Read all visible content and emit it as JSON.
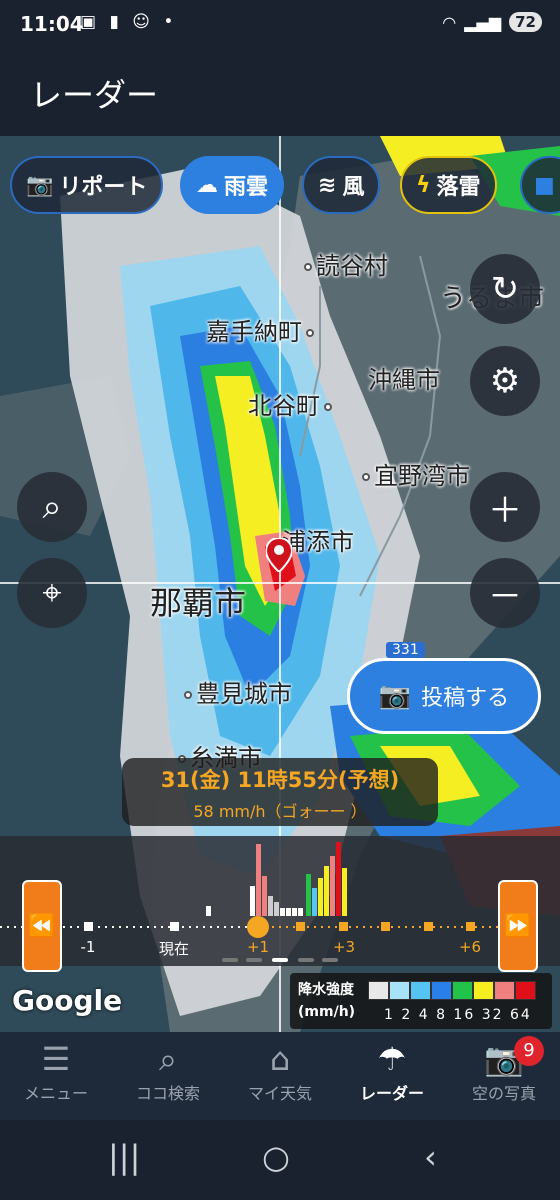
{
  "status": {
    "time": "11:04",
    "battery": "72"
  },
  "header": {
    "title": "レーダー"
  },
  "layers": [
    {
      "label": "リポート",
      "icon": "camera-icon"
    },
    {
      "label": "雨雲",
      "icon": "rain-cloud-icon"
    },
    {
      "label": "風",
      "icon": "wind-icon"
    },
    {
      "label": "落雷",
      "icon": "lightning-icon"
    }
  ],
  "places": {
    "yomitan": "読谷村",
    "uruma": "うるま市",
    "kadena": "嘉手納町",
    "okinawa": "沖縄市",
    "chatan": "北谷町",
    "ginowan": "宜野湾市",
    "urasoe": "浦添市",
    "naha": "那覇市",
    "tomigusuku": "豊見城市",
    "itoman": "糸満市",
    "route": "331"
  },
  "post_button": "投稿する",
  "forecast": {
    "time": "31(金) 11時55分(予想)",
    "intensity": "58 mm/h（ゴォーー ）"
  },
  "timeline": {
    "labels": {
      "minus1": "-1",
      "now": "現在",
      "plus1": "+1",
      "plus3": "+3",
      "plus6": "+6"
    }
  },
  "legend": {
    "title1": "降水強度",
    "title2": "(mm/h)",
    "values": "1 2 4 8 16 32 64",
    "colors": [
      "#e8e8e8",
      "#a8e2f8",
      "#55c4f2",
      "#2a7fe8",
      "#22c34a",
      "#f5ef22",
      "#f08080",
      "#e0101a"
    ]
  },
  "map_attribution": "Google",
  "nav": [
    {
      "label": "メニュー",
      "icon": "menu-icon"
    },
    {
      "label": "ココ検索",
      "icon": "search-icon"
    },
    {
      "label": "マイ天気",
      "icon": "home-icon"
    },
    {
      "label": "レーダー",
      "icon": "umbrella-icon"
    },
    {
      "label": "空の写真",
      "icon": "camera-icon",
      "badge": "9"
    }
  ]
}
